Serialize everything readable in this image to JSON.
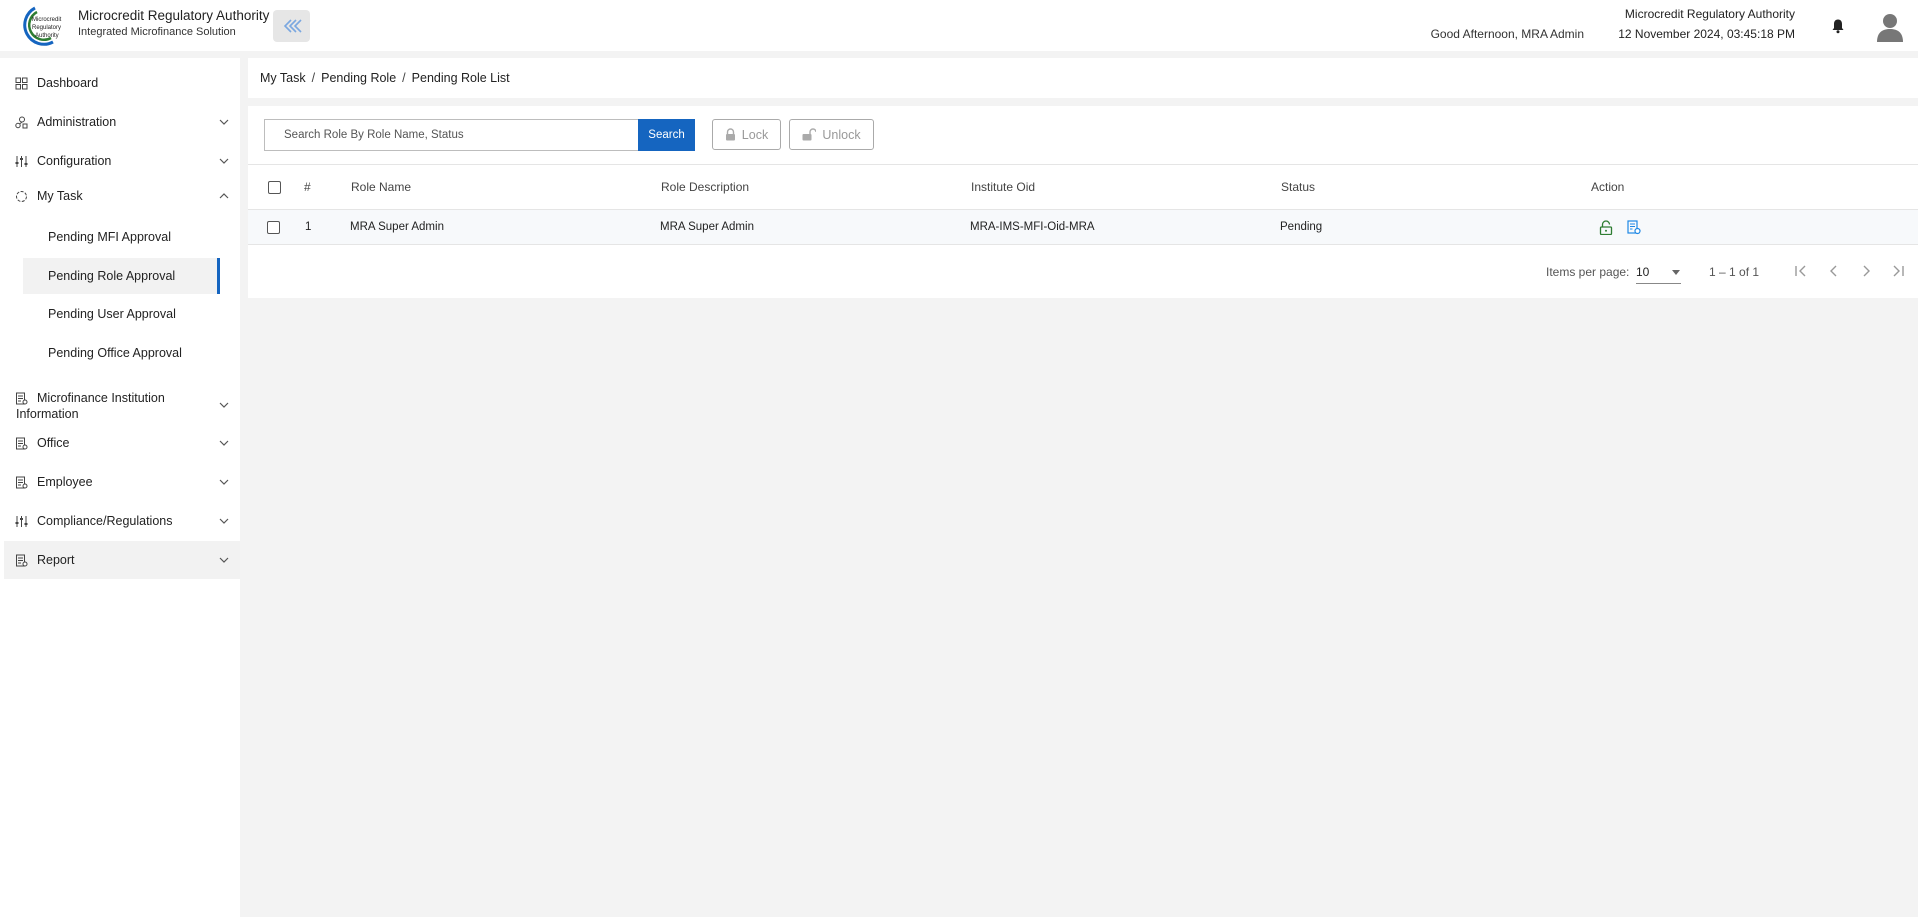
{
  "header": {
    "org_title": "Microcredit Regulatory Authority",
    "org_subtitle": "Integrated Microfinance Solution",
    "logo_text": "Microcredit Regulatory Authority",
    "greeting": "Good Afternoon, MRA Admin",
    "top_right_org": "Microcredit Regulatory Authority",
    "datetime": "12 November 2024, 03:45:18 PM",
    "accent_color": "#1565c0"
  },
  "sidebar": {
    "items": [
      {
        "label": "Dashboard",
        "icon": "dashboard-icon"
      },
      {
        "label": "Administration",
        "icon": "admin-icon"
      },
      {
        "label": "Configuration",
        "icon": "sliders-icon"
      },
      {
        "label": "My Task",
        "icon": "task-icon"
      },
      {
        "label": "Microfinance Institution Information",
        "icon": "document-icon"
      },
      {
        "label": "Office",
        "icon": "document-icon"
      },
      {
        "label": "Employee",
        "icon": "document-icon"
      },
      {
        "label": "Compliance/Regulations",
        "icon": "sliders-icon"
      },
      {
        "label": "Report",
        "icon": "document-icon"
      }
    ],
    "my_task_children": [
      {
        "label": "Pending MFI Approval"
      },
      {
        "label": "Pending Role Approval",
        "active": true
      },
      {
        "label": "Pending User Approval"
      },
      {
        "label": "Pending Office Approval"
      }
    ]
  },
  "breadcrumb": [
    "My Task",
    "Pending Role",
    "Pending Role List"
  ],
  "toolbar": {
    "search_placeholder": "Search Role By Role Name, Status",
    "search_label": "Search",
    "lock_label": "Lock",
    "unlock_label": "Unlock"
  },
  "table": {
    "columns": [
      "#",
      "Role Name",
      "Role Description",
      "Institute Oid",
      "Status",
      "Action"
    ],
    "rows": [
      {
        "index": "1",
        "role_name": "MRA Super Admin",
        "role_description": "MRA Super Admin",
        "institute_oid": "MRA-IMS-MFI-Oid-MRA",
        "status": "Pending"
      }
    ]
  },
  "paginator": {
    "items_per_page_label": "Items per page:",
    "page_size": "10",
    "range_label": "1 – 1 of 1"
  }
}
